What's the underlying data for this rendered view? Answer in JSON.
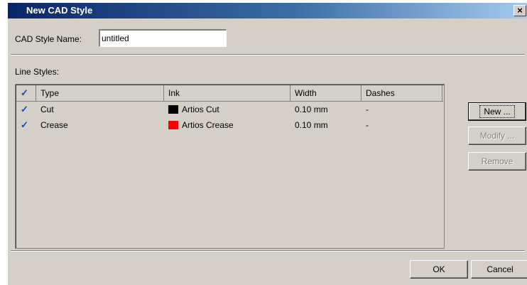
{
  "window": {
    "title": "New CAD Style",
    "close_glyph": "×"
  },
  "form": {
    "name_label": "CAD Style Name:",
    "name_value": "untitled"
  },
  "line_styles": {
    "label": "Line Styles:",
    "columns": {
      "check": "✓",
      "type": "Type",
      "ink": "Ink",
      "width": "Width",
      "dashes": "Dashes"
    },
    "rows": [
      {
        "checked": "✓",
        "type": "Cut",
        "ink": "Artios Cut",
        "ink_color": "#000000",
        "width": "0.10 mm",
        "dashes": "-"
      },
      {
        "checked": "✓",
        "type": "Crease",
        "ink": "Artios Crease",
        "ink_color": "#ff0000",
        "width": "0.10 mm",
        "dashes": "-"
      }
    ]
  },
  "side_buttons": {
    "new": "New ...",
    "modify": "Modify ...",
    "remove": "Remove"
  },
  "footer_buttons": {
    "ok": "OK",
    "cancel": "Cancel"
  },
  "colors": {
    "face": "#d4d0c8",
    "title_start": "#0a246a",
    "title_end": "#a6caf0",
    "check": "#1b3fd0"
  }
}
